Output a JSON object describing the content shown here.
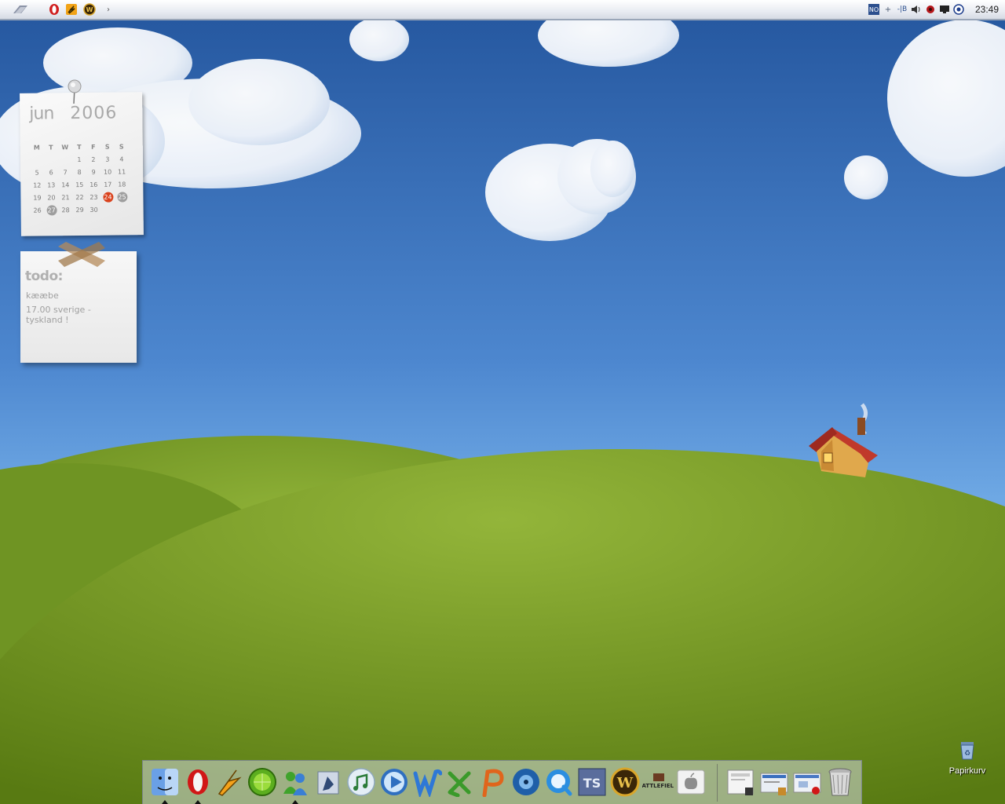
{
  "taskbar": {
    "clock": "23:49",
    "tray_text": "NO",
    "quicklaunch": [
      "opera-icon",
      "winamp-icon",
      "world-of-warcraft-icon"
    ]
  },
  "calendar": {
    "month": "jun",
    "year": "2006",
    "weekdays": [
      "M",
      "T",
      "W",
      "T",
      "F",
      "S",
      "S"
    ],
    "weeks": [
      [
        "",
        "",
        "",
        "1",
        "2",
        "3",
        "4"
      ],
      [
        "5",
        "6",
        "7",
        "8",
        "9",
        "10",
        "11"
      ],
      [
        "12",
        "13",
        "14",
        "15",
        "16",
        "17",
        "18"
      ],
      [
        "19",
        "20",
        "21",
        "22",
        "23",
        "24",
        "25"
      ],
      [
        "26",
        "27",
        "28",
        "29",
        "30",
        "",
        ""
      ]
    ],
    "today": "24",
    "highlighted": [
      "25",
      "27"
    ]
  },
  "todo": {
    "title": "todo:",
    "items": [
      "kææbe",
      "17.00 sverige - tyskland !"
    ]
  },
  "desktop": {
    "recycle_bin_label": "Papirkurv"
  },
  "dock": {
    "items": [
      "finder-icon",
      "opera-icon",
      "winamp-icon",
      "limewire-icon",
      "msn-messenger-icon",
      "mail-icon",
      "itunes-icon",
      "media-player-icon",
      "word-icon",
      "excel-icon",
      "powerpoint-icon",
      "dvd-icon",
      "quicktime-icon",
      "teamspeak-icon",
      "world-of-warcraft-icon",
      "battlefield-icon",
      "apple-icon"
    ],
    "labels": {
      "battlefield": "BATTLEFIELD",
      "teamspeak": "TS"
    },
    "minimized_windows": [
      "window-thumbnail-1",
      "window-thumbnail-2",
      "window-thumbnail-3"
    ]
  },
  "colors": {
    "sky_top": "#2a5da5",
    "sky_bottom": "#6aa6e2",
    "grass": "#7fa22a",
    "today_marker": "#d9421d"
  }
}
